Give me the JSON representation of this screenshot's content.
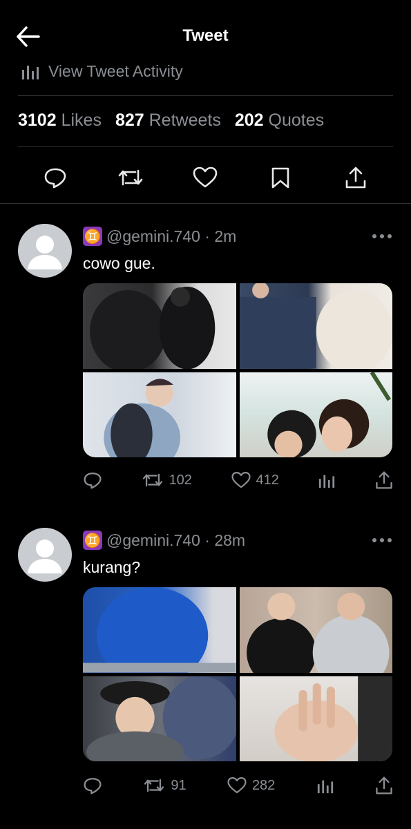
{
  "header": {
    "title": "Tweet"
  },
  "activity": {
    "label": "View Tweet Activity"
  },
  "stats": {
    "likes_count": "3102",
    "likes_label": "Likes",
    "retweets_count": "827",
    "retweets_label": "Retweets",
    "quotes_count": "202",
    "quotes_label": "Quotes"
  },
  "tweets": [
    {
      "zodiac": "♊",
      "handle": "@gemini.740",
      "time": "· 2m",
      "text": "cowo gue.",
      "retweets": "102",
      "likes": "412"
    },
    {
      "zodiac": "♊",
      "handle": "@gemini.740",
      "time": "· 28m",
      "text": "kurang?",
      "retweets": "91",
      "likes": "282"
    }
  ],
  "colors": {
    "background": "#000000",
    "muted": "#8b8f94",
    "divider": "#2f3336",
    "zodiac": "#8a3ab9"
  }
}
